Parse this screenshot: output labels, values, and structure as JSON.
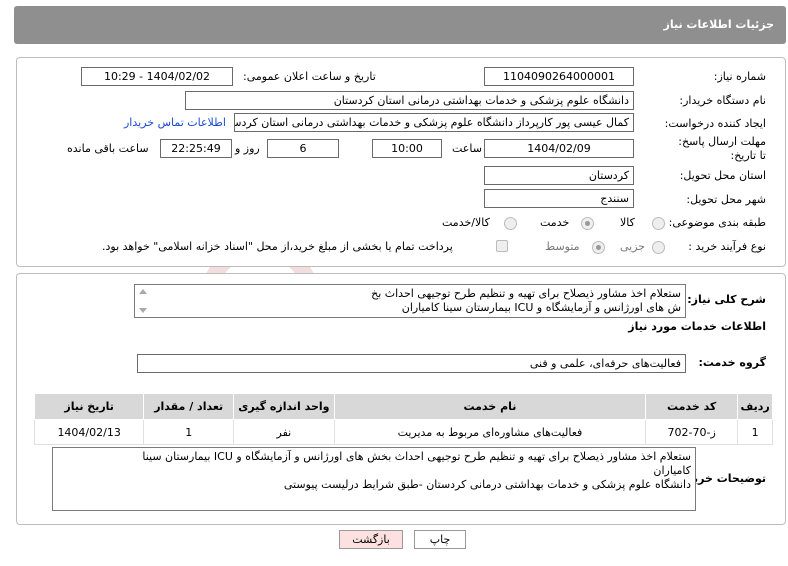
{
  "header": {
    "title": "جزئیات اطلاعات نیاز"
  },
  "form": {
    "need_number_label": "شماره نیاز:",
    "need_number": "1104090264000001",
    "announce_label": "تاریخ و ساعت اعلان عمومی:",
    "announce_value": "1404/02/02 - 10:29",
    "buyer_org_label": "نام دستگاه خریدار:",
    "buyer_org": "دانشگاه علوم پزشکی و خدمات بهداشتی  درمانی استان کردستان",
    "creator_label": "ایجاد کننده درخواست:",
    "creator": "کمال عیسی پور کارپرداز دانشگاه علوم پزشکی و خدمات بهداشتی  درمانی استان کردستان",
    "contact_link": "اطلاعات تماس خریدار",
    "deadline_label": "مهلت ارسال پاسخ: تا تاریخ:",
    "deadline_date": "1404/02/09",
    "time_label": "ساعت",
    "deadline_time": "10:00",
    "days_count": "6",
    "days_label": "روز و",
    "remaining_time": "22:25:49",
    "remaining_label": "ساعت باقی مانده",
    "province_label": "استان محل تحویل:",
    "province": "کردستان",
    "city_label": "شهر محل تحویل:",
    "city": "سنندج",
    "category_label": "طبقه بندی موضوعی:",
    "category_options": [
      "کالا",
      "خدمت",
      "کالا/خدمت"
    ],
    "category_selected": "خدمت",
    "process_label": "نوع فرآیند خرید :",
    "process_options": [
      "جزیی",
      "متوسط"
    ],
    "process_selected": "جزیی",
    "payment_note": "پرداخت تمام یا بخشی از مبلغ خرید،از محل \"اسناد خزانه اسلامی\" خواهد بود."
  },
  "summary": {
    "label": "شرح کلی نیاز:",
    "text_line1": "ستعلام اخذ مشاور ذیصلاح برای تهیه و تنظیم طرح توجیهی احداث بخ",
    "text_line2": "ش های اورژانس و آزمایشگاه و ICU بیمارستان سینا کامیاران"
  },
  "services": {
    "section_title": "اطلاعات خدمات مورد نیاز",
    "group_label": "گروه خدمت:",
    "group_value": "فعالیت‌های حرفه‌ای، علمی و فنی",
    "columns": [
      "ردیف",
      "کد خدمت",
      "نام خدمت",
      "واحد اندازه گیری",
      "تعداد / مقدار",
      "تاریخ نیاز"
    ],
    "rows": [
      {
        "index": "1",
        "code": "ز-70-702",
        "name": "فعالیت‌های مشاوره‌ای مربوط به مدیریت",
        "unit": "نفر",
        "qty": "1",
        "date": "1404/02/13"
      }
    ]
  },
  "buyer_notes": {
    "label": "توضیحات خریدار:",
    "line1": "ستعلام اخذ مشاور ذیصلاح برای تهیه و تنظیم طرح توجیهی احداث بخش های اورژانس و آزمایشگاه و ICU بیمارستان سینا",
    "line2": "کامیاران",
    "line3": "دانشگاه علوم پزشکی و خدمات بهداشتی درمانی کردستان -طبق شرایط درلیست پیوستی"
  },
  "buttons": {
    "print": "چاپ",
    "back": "بازگشت"
  },
  "watermark": "AriaTender.net",
  "colors": {
    "header_bg": "#8f8f8f",
    "link": "#1a4bd1",
    "back_button": "#fde0e0"
  }
}
